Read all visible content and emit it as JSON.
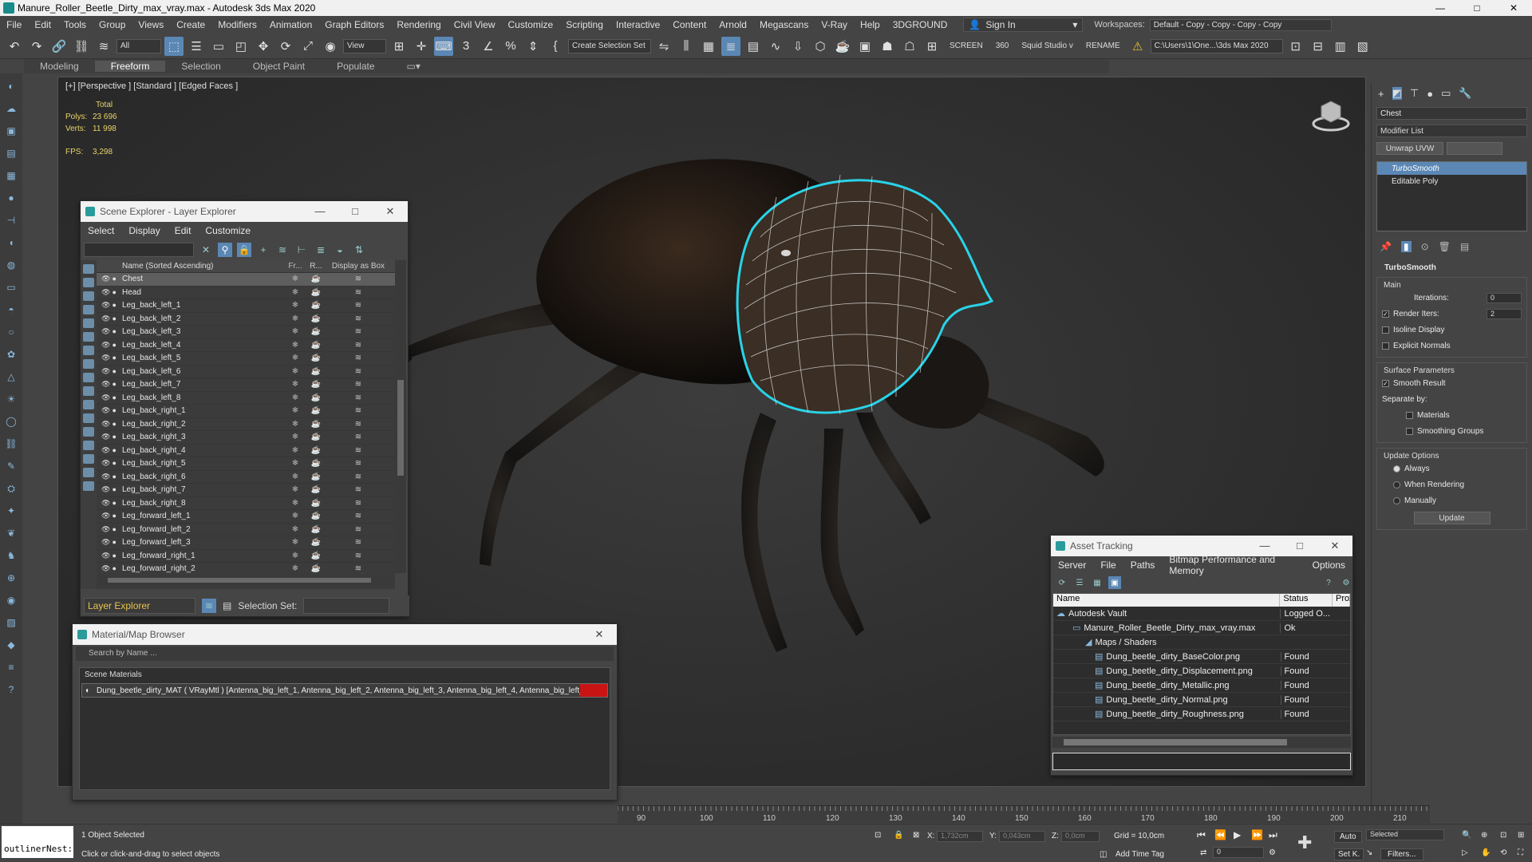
{
  "window": {
    "title": "Manure_Roller_Beetle_Dirty_max_vray.max - Autodesk 3ds Max 2020",
    "minimize": "—",
    "maximize": "□",
    "close": "✕"
  },
  "menu": {
    "items": [
      "File",
      "Edit",
      "Tools",
      "Group",
      "Views",
      "Create",
      "Modifiers",
      "Animation",
      "Graph Editors",
      "Rendering",
      "Civil View",
      "Customize",
      "Scripting",
      "Interactive",
      "Content",
      "Arnold",
      "Megascans",
      "V-Ray",
      "Help",
      "3DGROUND"
    ],
    "sign_in": "Sign In",
    "workspaces_label": "Workspaces:",
    "workspace_value": "Default - Copy - Copy - Copy - Copy"
  },
  "toolbar": {
    "filter_value": "All",
    "view_value": "View",
    "selection_set": "Create Selection Set",
    "screen_label": "SCREEN",
    "value_360": "360",
    "squid_label": "Squid Studio v",
    "rename_label": "RENAME",
    "project_path": "C:\\Users\\1\\One...\\3ds Max 2020"
  },
  "ribbon": {
    "tabs": [
      "Modeling",
      "Freeform",
      "Selection",
      "Object Paint",
      "Populate"
    ],
    "active": "Freeform"
  },
  "viewport": {
    "label": "[+] [Perspective ] [Standard ] [Edged Faces ]",
    "total_label": "Total",
    "polys_label": "Polys:",
    "polys_value": "23 696",
    "verts_label": "Verts:",
    "verts_value": "11 998",
    "fps_label": "FPS:",
    "fps_value": "3,298"
  },
  "scene_explorer": {
    "title": "Scene Explorer - Layer Explorer",
    "menu": [
      "Select",
      "Display",
      "Edit",
      "Customize"
    ],
    "columns": {
      "name": "Name (Sorted Ascending)",
      "frozen": "Fr...",
      "render": "R...",
      "box": "Display as Box"
    },
    "rows": [
      "Chest",
      "Head",
      "Leg_back_left_1",
      "Leg_back_left_2",
      "Leg_back_left_3",
      "Leg_back_left_4",
      "Leg_back_left_5",
      "Leg_back_left_6",
      "Leg_back_left_7",
      "Leg_back_left_8",
      "Leg_back_right_1",
      "Leg_back_right_2",
      "Leg_back_right_3",
      "Leg_back_right_4",
      "Leg_back_right_5",
      "Leg_back_right_6",
      "Leg_back_right_7",
      "Leg_back_right_8",
      "Leg_forward_left_1",
      "Leg_forward_left_2",
      "Leg_forward_left_3",
      "Leg_forward_right_1",
      "Leg_forward_right_2"
    ],
    "selected_row": "Chest",
    "explorer_dropdown": "Layer Explorer",
    "selection_set_label": "Selection Set:"
  },
  "material_browser": {
    "title": "Material/Map Browser",
    "search_placeholder": "Search by Name ...",
    "group_title": "Scene Materials",
    "material_row": "Dung_beetle_dirty_MAT   ( VRayMtl )   [Antenna_big_left_1,  Antenna_big_left_2,  Antenna_big_left_3,  Antenna_big_left_4,  Antenna_big_left_..."
  },
  "asset_tracking": {
    "title": "Asset Tracking",
    "menu": [
      "Server",
      "File",
      "Paths",
      "Bitmap Performance and Memory",
      "Options"
    ],
    "columns": {
      "name": "Name",
      "status": "Status",
      "proxy": "Prox"
    },
    "rows": [
      {
        "name": "Autodesk Vault",
        "status": "Logged O..."
      },
      {
        "name": "Manure_Roller_Beetle_Dirty_max_vray.max",
        "status": "Ok"
      },
      {
        "name": "Maps / Shaders",
        "status": ""
      },
      {
        "name": "Dung_beetle_dirty_BaseColor.png",
        "status": "Found"
      },
      {
        "name": "Dung_beetle_dirty_Displacement.png",
        "status": "Found"
      },
      {
        "name": "Dung_beetle_dirty_Metallic.png",
        "status": "Found"
      },
      {
        "name": "Dung_beetle_dirty_Normal.png",
        "status": "Found"
      },
      {
        "name": "Dung_beetle_dirty_Roughness.png",
        "status": "Found"
      }
    ]
  },
  "command_panel": {
    "object_name": "Chest",
    "modifier_list": "Modifier List",
    "unwrap_button": "Unwrap UVW",
    "stack": [
      "TurboSmooth",
      "Editable Poly"
    ],
    "rollout_title": "TurboSmooth",
    "main_label": "Main",
    "iterations_label": "Iterations:",
    "iterations_value": "0",
    "render_iters_label": "Render Iters:",
    "render_iters_value": "2",
    "isoline_label": "Isoline Display",
    "explicit_label": "Explicit Normals",
    "surface_label": "Surface Parameters",
    "smooth_result_label": "Smooth Result",
    "separate_label": "Separate by:",
    "materials_label": "Materials",
    "smoothing_label": "Smoothing Groups",
    "update_options_label": "Update Options",
    "always_label": "Always",
    "when_rendering_label": "When Rendering",
    "manually_label": "Manually",
    "update_button": "Update"
  },
  "timeline": {
    "ticks": [
      "90",
      "100",
      "110",
      "120",
      "130",
      "140",
      "150",
      "160",
      "170",
      "180",
      "190",
      "200",
      "210",
      "220"
    ]
  },
  "status": {
    "command_text": "outlinerNest:",
    "selected_text": "1 Object Selected",
    "prompt_text": "Click or click-and-drag to select objects",
    "x_label": "X:",
    "x_value": "1,732cm",
    "y_label": "Y:",
    "y_value": "0,043cm",
    "z_label": "Z:",
    "z_value": "0,0cm",
    "grid": "Grid = 10,0cm",
    "add_time_tag": "Add Time Tag",
    "frame_value": "0",
    "auto": "Auto",
    "selected_dd": "Selected",
    "set_k": "Set K.",
    "filters": "Filters..."
  }
}
